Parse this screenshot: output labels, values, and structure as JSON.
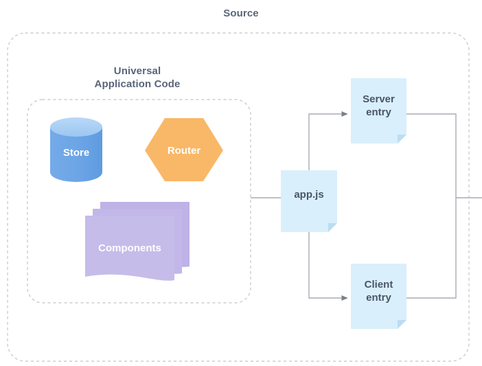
{
  "diagram": {
    "title": "Source",
    "groups": [
      {
        "id": "universal-application-code",
        "title": "Universal\nApplication Code"
      }
    ],
    "nodes": [
      {
        "id": "store",
        "label": "Store",
        "shape": "cylinder",
        "color": "#6FA8E6",
        "top_color": "#A7CCF2",
        "text_color": "#FFFFFF"
      },
      {
        "id": "router",
        "label": "Router",
        "shape": "hexagon",
        "color": "#F9B867",
        "text_color": "#FFFFFF"
      },
      {
        "id": "components",
        "label": "Components",
        "shape": "document-stack",
        "color": "#C6BCEA",
        "text_color": "#FFFFFF"
      },
      {
        "id": "app-js",
        "label": "app.js",
        "shape": "document",
        "color": "#D9EFFB",
        "text_color": "#4A5568"
      },
      {
        "id": "server-entry",
        "label": "Server\nentry",
        "shape": "document",
        "color": "#D9EFFB",
        "text_color": "#4A5568"
      },
      {
        "id": "client-entry",
        "label": "Client\nentry",
        "shape": "document",
        "color": "#D9EFFB",
        "text_color": "#4A5568"
      }
    ],
    "edges": [
      {
        "from": "universal-application-code",
        "to": "app-js",
        "arrow": false
      },
      {
        "from": "app-js",
        "to": "server-entry",
        "arrow": true
      },
      {
        "from": "app-js",
        "to": "client-entry",
        "arrow": true
      },
      {
        "from": "server-entry",
        "to": "output",
        "arrow": false
      },
      {
        "from": "client-entry",
        "to": "output",
        "arrow": false
      }
    ],
    "colors": {
      "title_text": "#5A6578",
      "node_text": "#4A5568",
      "dashed_border": "#C9CDD4",
      "connector": "#A7ABB3",
      "background": "#FFFFFF"
    }
  }
}
